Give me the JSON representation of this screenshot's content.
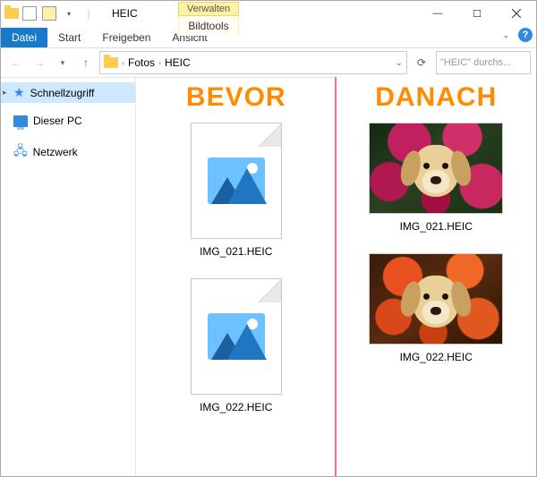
{
  "colors": {
    "accent": "#ff8c00",
    "divider": "#ff6b7a"
  },
  "titlebar": {
    "title": "HEIC"
  },
  "ribbon": {
    "file": "Datei",
    "tabs": [
      "Start",
      "Freigeben",
      "Ansicht"
    ],
    "context_header": "Verwalten",
    "context_tab": "Bildtools"
  },
  "address": {
    "segments": [
      "Fotos",
      "HEIC"
    ]
  },
  "search": {
    "placeholder": "\"HEIC\" durchs..."
  },
  "navpane": {
    "items": [
      {
        "label": "Schnellzugriff",
        "icon": "star",
        "selected": true,
        "expandable": true
      },
      {
        "label": "Dieser PC",
        "icon": "pc"
      },
      {
        "label": "Netzwerk",
        "icon": "network"
      }
    ]
  },
  "compare": {
    "left_header": "BEVOR",
    "right_header": "DANACH"
  },
  "files": [
    {
      "name": "IMG_021.HEIC"
    },
    {
      "name": "IMG_022.HEIC"
    }
  ]
}
